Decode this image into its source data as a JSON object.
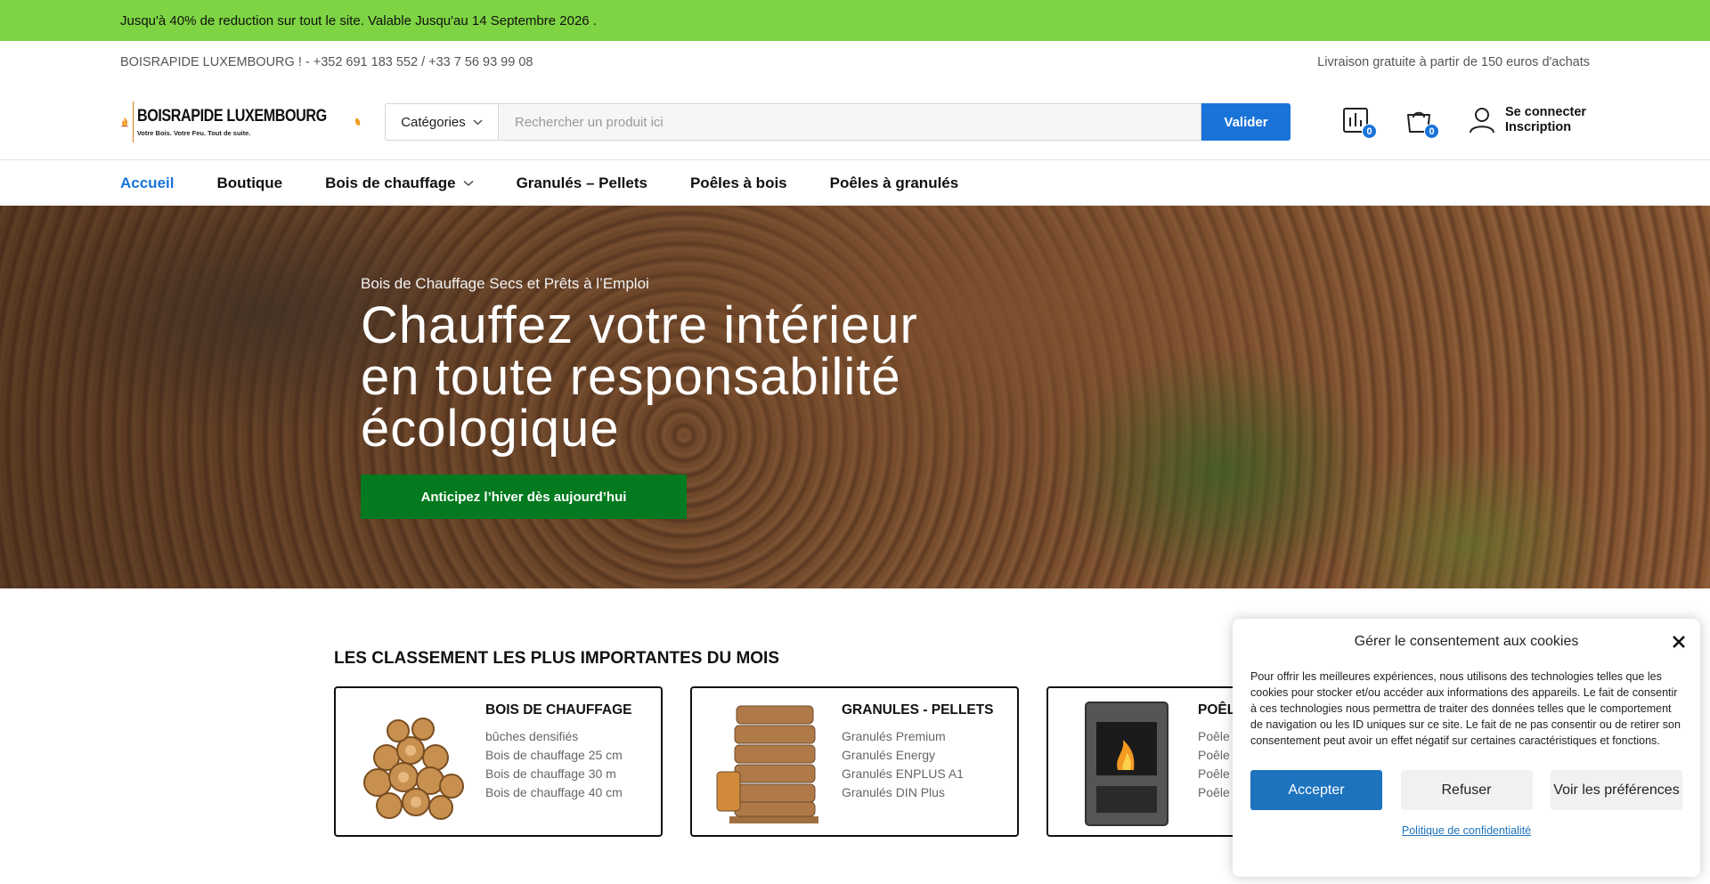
{
  "promo": {
    "text": "Jusqu'à 40% de reduction sur tout le site. Valable Jusqu'au 14 Septembre 2026 ."
  },
  "info": {
    "contact": "BOISRAPIDE LUXEMBOURG ! - +352 691 183 552 / +33 7 56 93 99 08",
    "shipping": "Livraison gratuite à partir de 150 euros d'achats"
  },
  "logo": {
    "title": "BOISRAPIDE LUXEMBOURG",
    "tagline": "Votre Bois. Votre Feu. Tout de suite."
  },
  "search": {
    "category_label": "Catégories",
    "placeholder": "Rechercher un produit ici",
    "button": "Valider"
  },
  "header": {
    "compare_count": "0",
    "cart_count": "0",
    "login": "Se connecter",
    "register": "Inscription"
  },
  "nav": {
    "items": [
      {
        "label": "Accueil"
      },
      {
        "label": "Boutique"
      },
      {
        "label": "Bois de chauffage"
      },
      {
        "label": "Granulés – Pellets"
      },
      {
        "label": "Poêles à bois"
      },
      {
        "label": "Poêles à granulés"
      }
    ]
  },
  "hero": {
    "kicker": "Bois de Chauffage Secs et Prêts à l’Emploi",
    "title_line1": "Chauffez votre intérieur",
    "title_line2": "en toute responsabilité",
    "title_line3": "écologique",
    "cta": "Anticipez l’hiver dès aujourd’hui"
  },
  "rankings": {
    "title": "LES CLASSEMENT LES PLUS IMPORTANTES DU MOIS",
    "cards": [
      {
        "title": "BOIS DE CHAUFFAGE",
        "links": [
          "bûches densifiés",
          "Bois de chauffage 25 cm",
          "Bois de chauffage 30 m",
          "Bois de chauffage 40 cm"
        ]
      },
      {
        "title": "GRANULES - PELLETS",
        "links": [
          "Granulés Premium",
          "Granulés Energy",
          "Granulés ENPLUS A1",
          "Granulés DIN Plus"
        ]
      },
      {
        "title": "POÊLES À GRANULÉS",
        "links": [
          "Poêle",
          "Poêle",
          "Poêle",
          "Poêle"
        ]
      }
    ]
  },
  "cookie": {
    "title": "Gérer le consentement aux cookies",
    "text": "Pour offrir les meilleures expériences, nous utilisons des technologies telles que les cookies pour stocker et/ou accéder aux informations des appareils. Le fait de consentir à ces technologies nous permettra de traiter des données telles que le comportement de navigation ou les ID uniques sur ce site. Le fait de ne pas consentir ou de retirer son consentement peut avoir un effet négatif sur certaines caractéristiques et fonctions.",
    "accept": "Accepter",
    "refuse": "Refuser",
    "prefs": "Voir les préférences",
    "policy": "Politique de confidentialité"
  },
  "colors": {
    "promo": "#7ed443",
    "accent": "#1a73d9",
    "cta": "#037a1f",
    "cookie_accent": "#1e73be"
  }
}
